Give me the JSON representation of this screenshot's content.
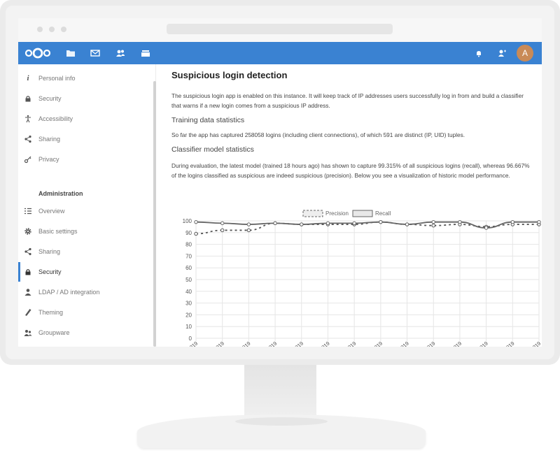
{
  "header": {
    "logo_name": "nextcloud-logo",
    "avatar_initial": "A",
    "color": "#3a82d2"
  },
  "sidebar": {
    "personal": [
      {
        "label": "Personal info",
        "icon": "info-icon"
      },
      {
        "label": "Security",
        "icon": "lock-icon"
      },
      {
        "label": "Accessibility",
        "icon": "accessibility-icon"
      },
      {
        "label": "Sharing",
        "icon": "share-icon"
      },
      {
        "label": "Privacy",
        "icon": "key-icon"
      }
    ],
    "admin_heading": "Administration",
    "admin": [
      {
        "label": "Overview",
        "icon": "list-icon"
      },
      {
        "label": "Basic settings",
        "icon": "gear-icon"
      },
      {
        "label": "Sharing",
        "icon": "share-icon"
      },
      {
        "label": "Security",
        "icon": "lock-icon",
        "active": true
      },
      {
        "label": "LDAP / AD integration",
        "icon": "user-icon"
      },
      {
        "label": "Theming",
        "icon": "brush-icon"
      },
      {
        "label": "Groupware",
        "icon": "groupware-icon"
      }
    ]
  },
  "main": {
    "title": "Suspicious login detection",
    "intro": "The suspicious login app is enabled on this instance. It will keep track of IP addresses users successfully log in from and build a classifier that warns if a new login comes from a suspicious IP address.",
    "training_heading": "Training data statistics",
    "training_text": "So far the app has captured 258058 logins (including client connections), of which 591 are distinct (IP, UID) tuples.",
    "classifier_heading": "Classifier model statistics",
    "classifier_text": "During evaluation, the latest model (trained 18 hours ago) has shown to capture 99.315% of all suspicious logins (recall), whereas 96.667% of the logins classified as suspicious are indeed suspicious (precision). Below you see a visualization of historic model performance."
  },
  "chart_data": {
    "type": "line",
    "categories": [
      "21/03/2019",
      "22/03/2019",
      "23/03/2019",
      "24/03/2019",
      "25/03/2019",
      "26/03/2019",
      "27/03/2019",
      "28/03/2019",
      "29/03/2019",
      "30/03/2019",
      "31/03/2019",
      "01/04/2019",
      "02/04/2019",
      "03/04/2019"
    ],
    "series": [
      {
        "name": "Precision",
        "values": [
          89,
          92,
          92,
          98,
          97,
          97,
          97,
          99,
          97,
          96,
          97,
          95,
          97,
          97
        ],
        "style": "dashed",
        "color": "#555555"
      },
      {
        "name": "Recall",
        "values": [
          99,
          98,
          97,
          98,
          97,
          98,
          98,
          99,
          97,
          99,
          99,
          94,
          99,
          99
        ],
        "style": "solid",
        "color": "#666666"
      }
    ],
    "ylim": [
      0,
      100
    ],
    "yticks": [
      0,
      10,
      20,
      30,
      40,
      50,
      60,
      70,
      80,
      90,
      100
    ],
    "grid": true,
    "legend": "top"
  }
}
